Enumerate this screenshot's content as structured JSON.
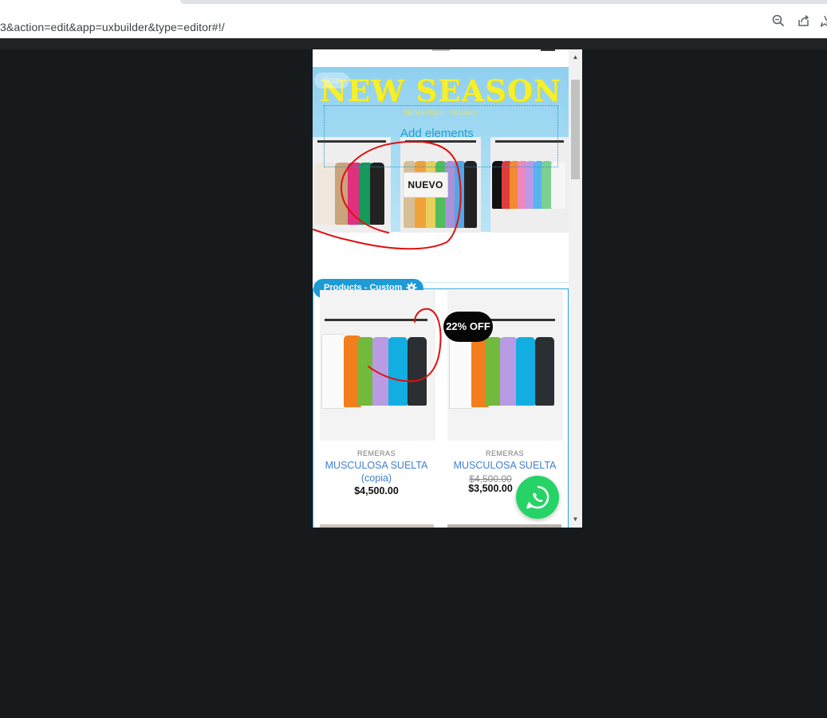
{
  "browser": {
    "url": "3&action=edit&app=uxbuilder&type=editor#!/",
    "icons": [
      "zoom-icon",
      "share-icon",
      "bookmark-star-icon"
    ]
  },
  "banner": {
    "gap_label": "Gap",
    "title": "NEW SEASON",
    "subtitle": "PRIMAVERA - VERANO",
    "add_elements": "Add elements",
    "button_label": "NUEVO"
  },
  "products_block": {
    "tag_label": "Products - Custom",
    "icon": "gear-icon",
    "items": [
      {
        "category": "REMERAS",
        "name": "MUSCULOSA SUELTA (copia)",
        "price": "$4,500.00"
      },
      {
        "category": "REMERAS",
        "name": "MUSCULOSA SUELTA",
        "old_price": "$4,500.00",
        "price": "$3,500.00",
        "badge": "22% OFF"
      }
    ]
  },
  "floating": {
    "icon": "whatsapp-icon"
  },
  "colors": {
    "accent": "#1c9bd7",
    "link": "#3f7fce",
    "banner_title": "#f6ef2c",
    "whatsapp": "#25d366",
    "annotation": "#e01010"
  }
}
